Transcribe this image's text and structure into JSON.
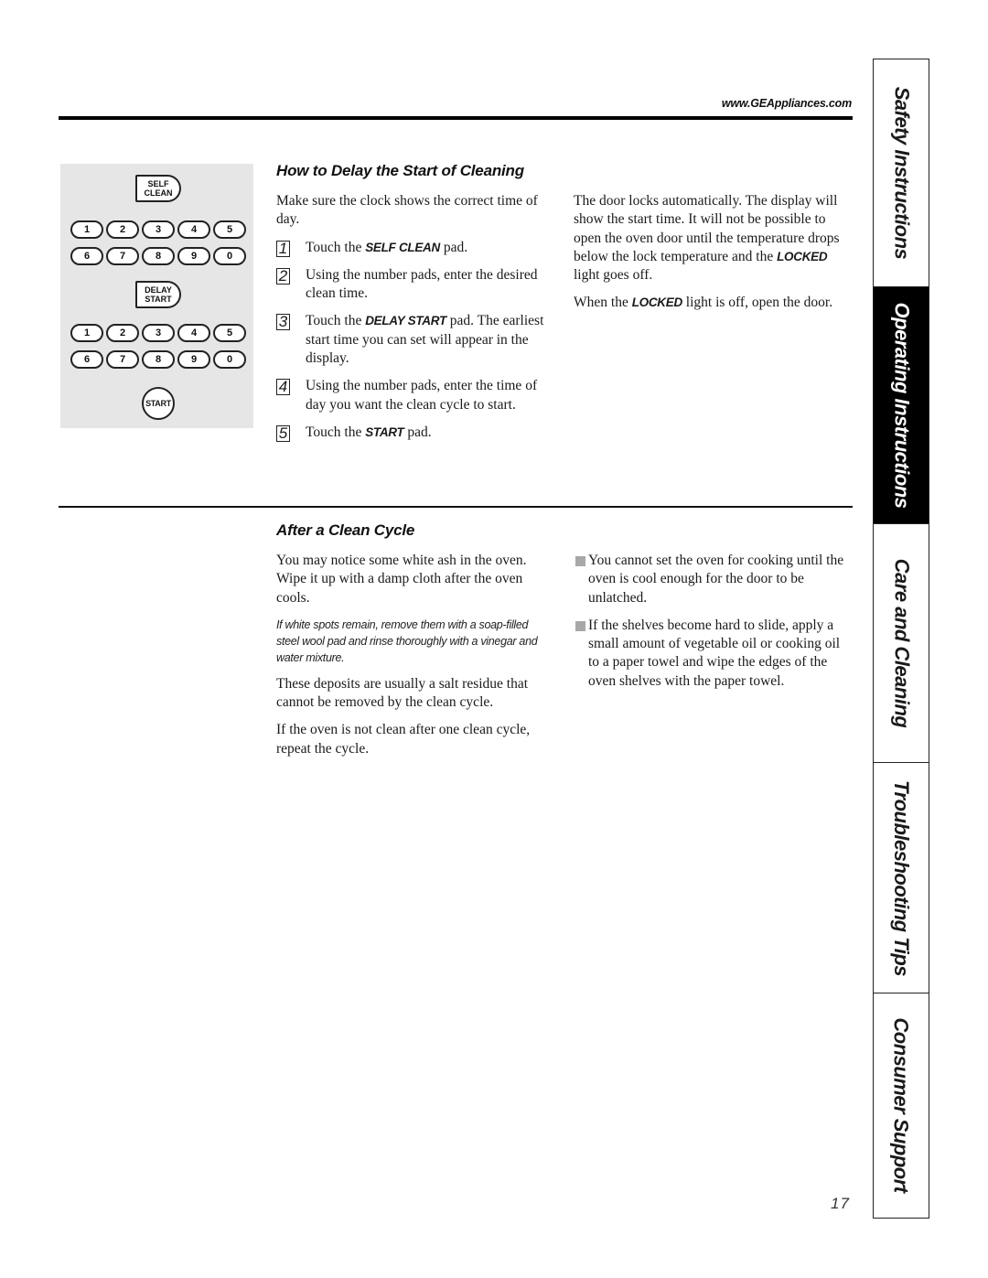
{
  "header": {
    "url": "www.GEAppliances.com"
  },
  "keypad": {
    "self_clean_label_1": "SELF",
    "self_clean_label_2": "CLEAN",
    "delay_start_label_1": "DELAY",
    "delay_start_label_2": "START",
    "start_label": "START",
    "row_a": [
      "1",
      "2",
      "3",
      "4",
      "5"
    ],
    "row_b": [
      "6",
      "7",
      "8",
      "9",
      "0"
    ]
  },
  "delay_section": {
    "title": "How to Delay the Start of Cleaning",
    "intro": "Make sure the clock shows the correct time of day.",
    "steps": [
      {
        "num": "1",
        "pre": "Touch the ",
        "bold": "SELF CLEAN",
        "post": " pad."
      },
      {
        "num": "2",
        "pre": "Using the number pads, enter the desired clean time.",
        "bold": "",
        "post": ""
      },
      {
        "num": "3",
        "pre": "Touch the ",
        "bold": "DELAY START",
        "post": " pad. The earliest start time you can set will appear in the display."
      },
      {
        "num": "4",
        "pre": "Using the number pads, enter the time of day you want the clean cycle to start.",
        "bold": "",
        "post": ""
      },
      {
        "num": "5",
        "pre": "Touch the ",
        "bold": "START",
        "post": " pad."
      }
    ],
    "right_p1_pre": "The door locks automatically. The display will show the start time. It will not be possible to open the oven door until the temperature drops below the lock temperature and the ",
    "right_p1_bold": "LOCKED",
    "right_p1_post": " light goes off.",
    "right_p2_pre": "When the ",
    "right_p2_bold": "LOCKED",
    "right_p2_post": " light is off, open the door."
  },
  "after_section": {
    "title": "After a Clean Cycle",
    "p1": "You may notice some white ash in the oven. Wipe it up with a damp cloth after the oven cools.",
    "note": "If white spots remain, remove them with a soap-filled steel wool pad and rinse thoroughly with a vinegar and water mixture.",
    "p2": "These deposits are usually a salt residue that cannot be removed by the clean cycle.",
    "p3": "If the oven is not clean after one clean cycle, repeat the cycle.",
    "bullets": [
      "You cannot set the oven for cooking until the oven is cool enough for the door to be unlatched.",
      "If the shelves become hard to slide, apply a small amount of vegetable oil or cooking oil to a paper towel and wipe the edges of the oven shelves with the paper towel."
    ]
  },
  "side_tabs": [
    {
      "label": "Safety Instructions",
      "active": false
    },
    {
      "label": "Operating Instructions",
      "active": true
    },
    {
      "label": "Care and Cleaning",
      "active": false
    },
    {
      "label": "Troubleshooting Tips",
      "active": false
    },
    {
      "label": "Consumer Support",
      "active": false
    }
  ],
  "page_number": "17"
}
